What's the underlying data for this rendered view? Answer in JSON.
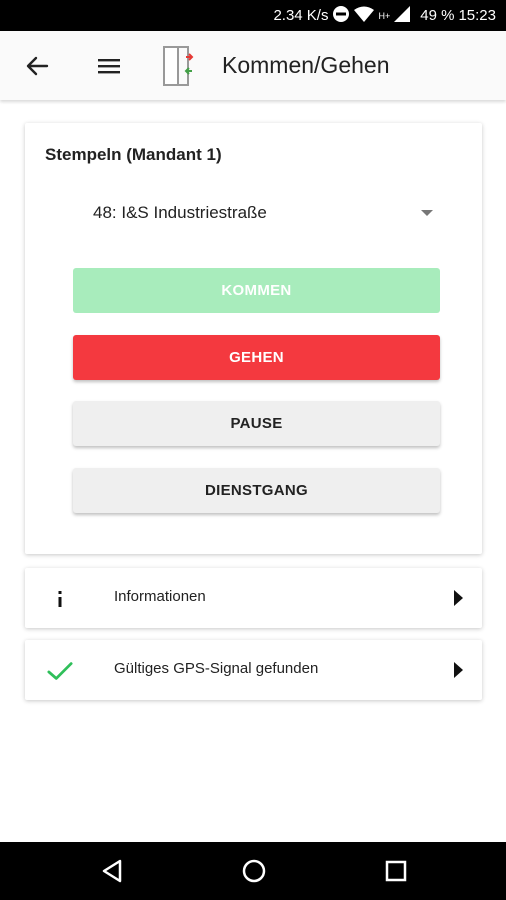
{
  "status_bar": {
    "speed": "2.34 K/s",
    "network": "H+",
    "battery": "49 %",
    "time": "15:23"
  },
  "app_bar": {
    "title": "Kommen/Gehen"
  },
  "stamp_card": {
    "title": "Stempeln (Mandant 1)",
    "location_select": {
      "value": "48: I&S Industriestraße"
    },
    "buttons": {
      "kommen": "KOMMEN",
      "gehen": "GEHEN",
      "pause": "PAUSE",
      "dienstgang": "DIENSTGANG"
    }
  },
  "rows": [
    {
      "label": "Informationen",
      "icon": "info-icon"
    },
    {
      "label": "Gültiges GPS-Signal gefunden",
      "icon": "checkmark-icon"
    }
  ],
  "colors": {
    "kommen_disabled": "#a8ecbc",
    "gehen": "#f4393f",
    "neutral_button": "#efefef",
    "check_green": "#2fbf5a"
  }
}
